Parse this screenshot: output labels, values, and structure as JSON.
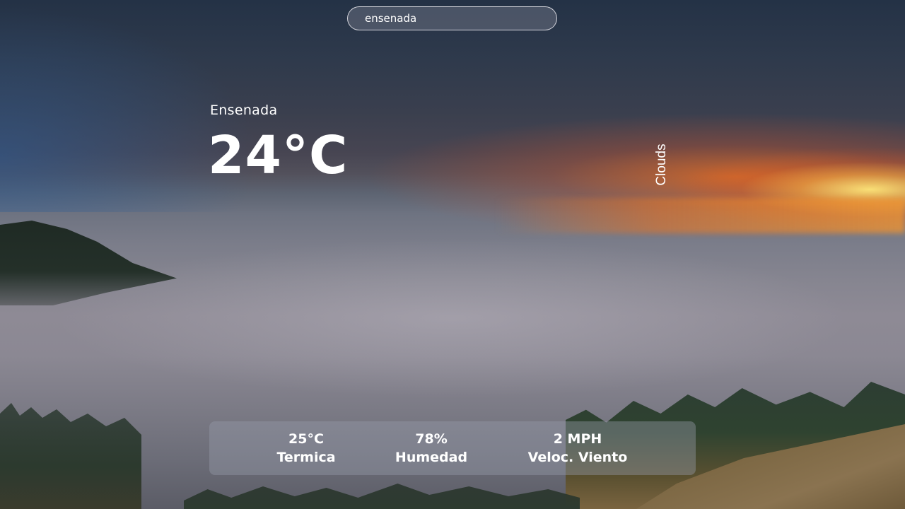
{
  "search": {
    "value": "ensenada",
    "placeholder": ""
  },
  "weather": {
    "city": "Ensenada",
    "temperature": "24°C",
    "condition": "Clouds"
  },
  "stats": {
    "feels_like": {
      "value": "25°C",
      "label": "Termica"
    },
    "humidity": {
      "value": "78%",
      "label": "Humedad"
    },
    "wind_speed": {
      "value": "2 MPH",
      "label": "Veloc. Viento"
    }
  },
  "theme": {
    "text_color": "#ffffff",
    "panel_color": "rgba(150,155,170,0.42)"
  }
}
